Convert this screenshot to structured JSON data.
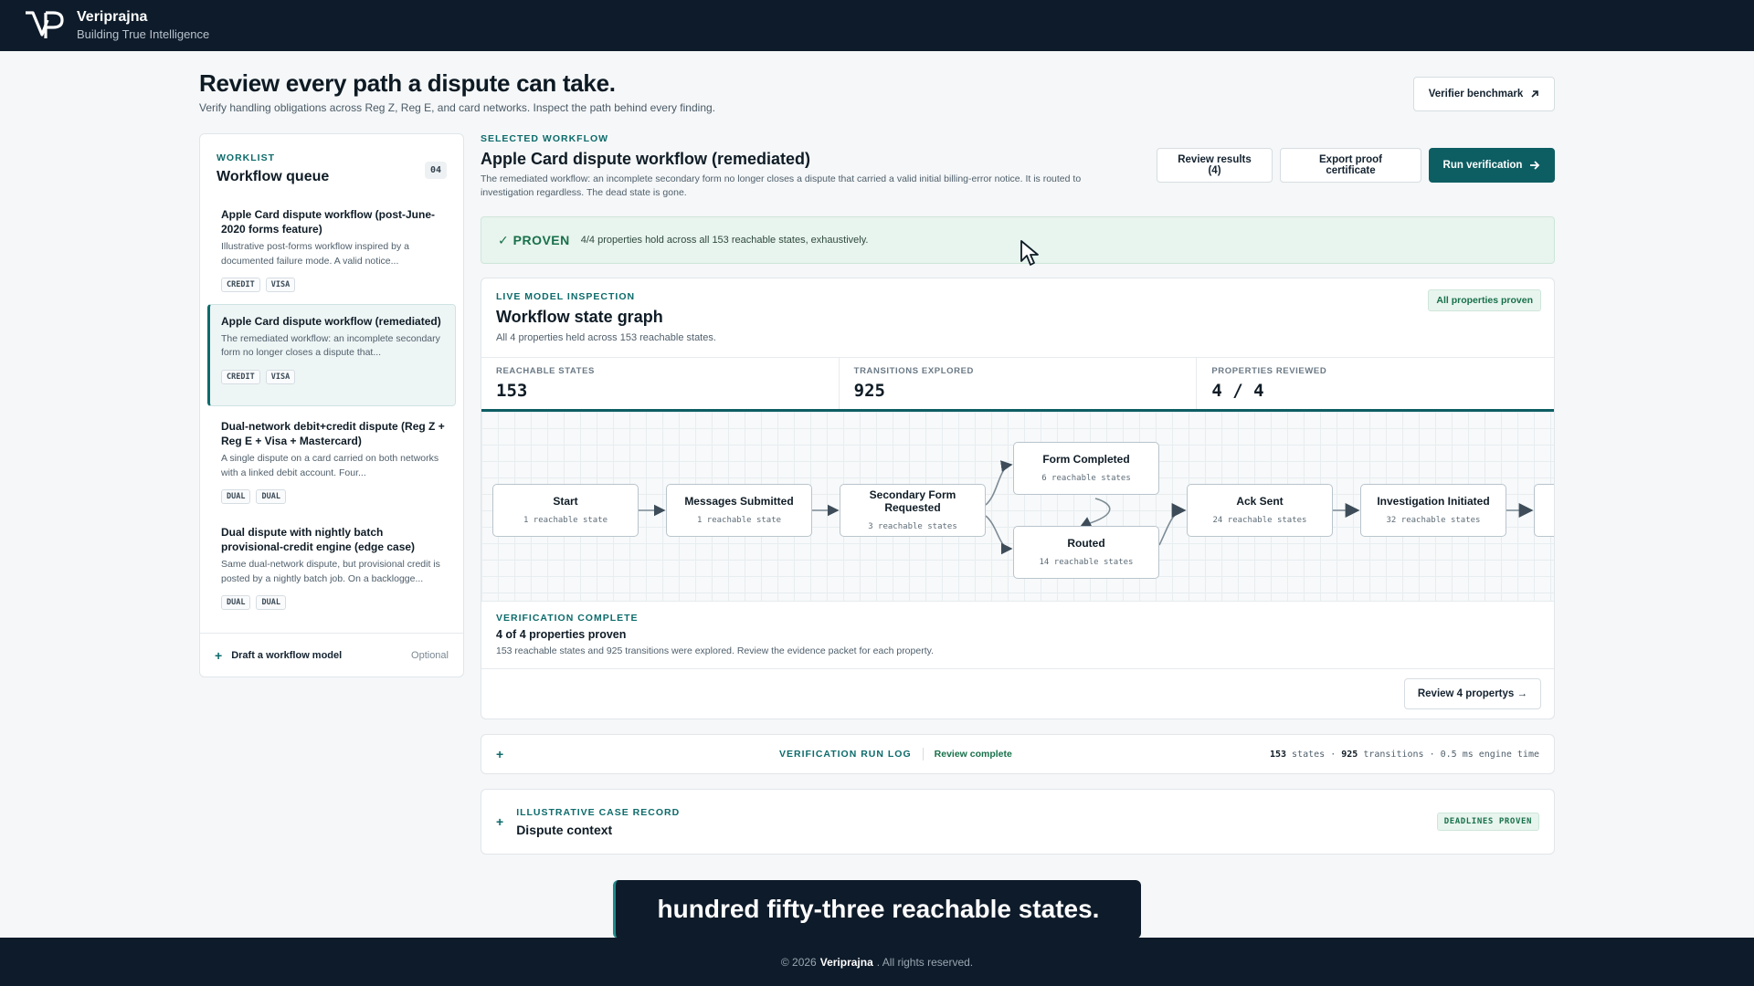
{
  "app": {
    "brand_name": "Veriprajna",
    "brand_tagline": "Building True Intelligence"
  },
  "hero": {
    "title": "Review every path a dispute can take.",
    "subtitle": "Verify handling obligations across Reg Z, Reg E, and card networks. Inspect the path behind every finding.",
    "benchmark_label": "Verifier benchmark"
  },
  "worklist": {
    "eyebrow": "WORKLIST",
    "title": "Workflow queue",
    "count": "04",
    "items": [
      {
        "title": "Apple Card dispute workflow (post-June-2020 forms feature)",
        "desc": "Illustrative post-forms workflow inspired by a documented failure mode. A valid notice...",
        "tags": [
          "CREDIT",
          "VISA"
        ]
      },
      {
        "title": "Apple Card dispute workflow (remediated)",
        "desc": "The remediated workflow: an incomplete secondary form no longer closes a dispute that...",
        "tags": [
          "CREDIT",
          "VISA"
        ]
      },
      {
        "title": "Dual-network debit+credit dispute (Reg Z + Reg E + Visa + Mastercard)",
        "desc": "A single dispute on a card carried on both networks with a linked debit account. Four...",
        "tags": [
          "DUAL",
          "DUAL"
        ]
      },
      {
        "title": "Dual dispute with nightly batch provisional-credit engine (edge case)",
        "desc": "Same dual-network dispute, but provisional credit is posted by a nightly batch job. On a backlogge...",
        "tags": [
          "DUAL",
          "DUAL"
        ]
      }
    ],
    "draft_label": "Draft a workflow model",
    "draft_optional": "Optional"
  },
  "selected": {
    "eyebrow": "SELECTED WORKFLOW",
    "title": "Apple Card dispute workflow (remediated)",
    "desc": "The remediated workflow: an incomplete secondary form no longer closes a dispute that carried a valid initial billing-error notice. It is routed to investigation regardless. The dead state is gone.",
    "review_results_label": "Review results (4)",
    "export_label": "Export proof certificate",
    "run_label": "Run verification"
  },
  "proven": {
    "label": "PROVEN",
    "text": "4/4 properties hold across all 153 reachable states, exhaustively."
  },
  "graph": {
    "eyebrow": "LIVE MODEL INSPECTION",
    "title": "Workflow state graph",
    "subtitle": "All 4 properties held across 153 reachable states.",
    "badge": "All properties proven",
    "stats": [
      {
        "label": "REACHABLE STATES",
        "value": "153"
      },
      {
        "label": "TRANSITIONS EXPLORED",
        "value": "925"
      },
      {
        "label": "PROPERTIES REVIEWED",
        "value": "4 / 4"
      }
    ],
    "nodes": [
      {
        "name": "Start",
        "count": "1 reachable state"
      },
      {
        "name": "Messages Submitted",
        "count": "1 reachable state"
      },
      {
        "name": "Secondary Form Requested",
        "count": "3 reachable states"
      },
      {
        "name": "Form Completed",
        "count": "6 reachable states"
      },
      {
        "name": "Routed",
        "count": "14 reachable states"
      },
      {
        "name": "Ack Sent",
        "count": "24 reachable states"
      },
      {
        "name": "Investigation Initiated",
        "count": "32 reachable states"
      }
    ]
  },
  "verification": {
    "eyebrow": "VERIFICATION COMPLETE",
    "title": "4 of 4 properties proven",
    "desc": "153 reachable states and 925 transitions were explored. Review the evidence packet for each property.",
    "review_button": "Review 4 propertys →"
  },
  "runlog": {
    "label": "VERIFICATION RUN LOG",
    "status": "Review complete",
    "states": "153",
    "states_unit": "states",
    "transitions": "925",
    "transitions_unit": "transitions",
    "engine_time": "0.5 ms engine time"
  },
  "caserecord": {
    "eyebrow": "ILLUSTRATIVE CASE RECORD",
    "title": "Dispute context",
    "badge": "DEADLINES PROVEN"
  },
  "caption": "hundred fifty-three reachable states.",
  "footer": {
    "prefix": "© 2026",
    "brand": "Veriprajna",
    "suffix": ". All rights reserved."
  },
  "colors": {
    "header_bg": "#0e1b2a",
    "accent_teal": "#0d5e63",
    "proven_green": "#17704a",
    "proven_bg": "#e8f4ee"
  }
}
